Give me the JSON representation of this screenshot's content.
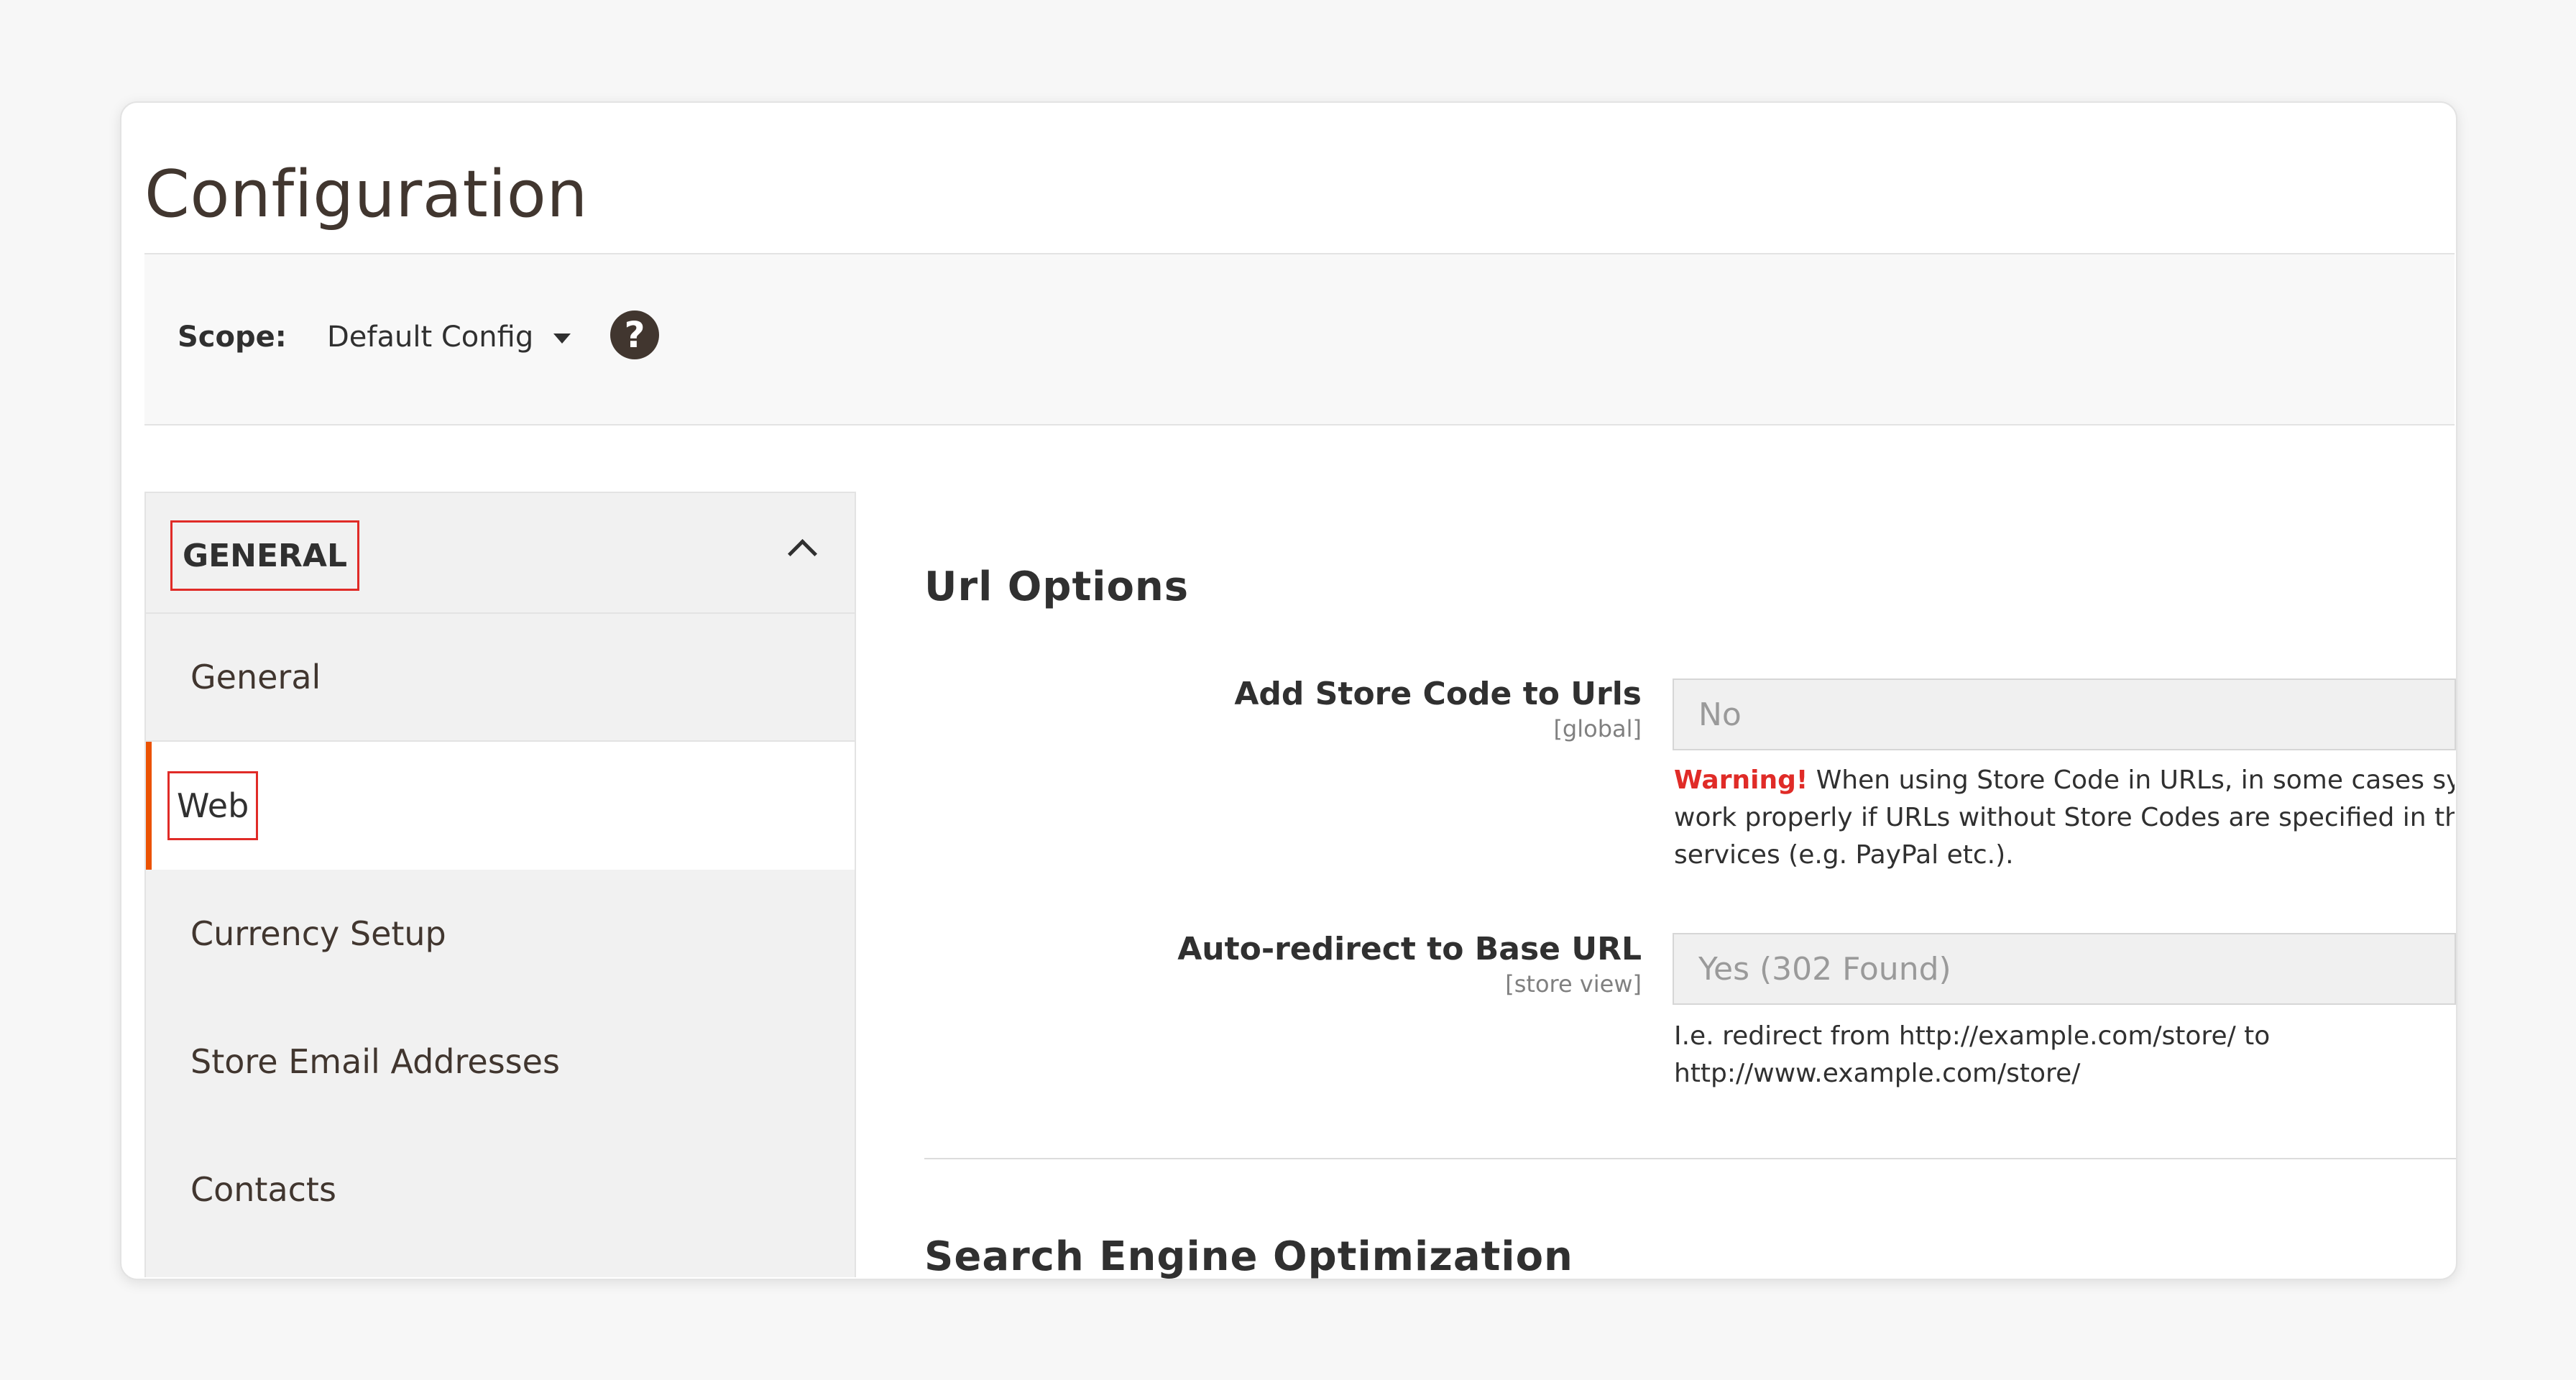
{
  "page": {
    "title": "Configuration"
  },
  "scope": {
    "label": "Scope:",
    "value": "Default Config"
  },
  "sidebar": {
    "section_title": "GENERAL",
    "items": [
      {
        "label": "General"
      },
      {
        "label": "Web"
      },
      {
        "label": "Currency Setup"
      },
      {
        "label": "Store Email Addresses"
      },
      {
        "label": "Contacts"
      }
    ],
    "active_item": "Web"
  },
  "main": {
    "url_options": {
      "title": "Url Options",
      "add_store_code": {
        "label": "Add Store Code to Urls",
        "scope": "[global]",
        "value": "No",
        "note_warning": "Warning!",
        "note_line1": " When using Store Code in URLs, in some cases syster",
        "note_line2": "work properly if URLs without Store Codes are specified in the t",
        "note_line3": "services (e.g. PayPal etc.)."
      },
      "auto_redirect": {
        "label": "Auto-redirect to Base URL",
        "scope": "[store view]",
        "value": "Yes (302 Found)",
        "note_line1": "I.e. redirect from http://example.com/store/ to",
        "note_line2": "http://www.example.com/store/"
      }
    },
    "seo": {
      "title": "Search Engine Optimization"
    }
  },
  "colors": {
    "accent": "#eb5202",
    "highlight_box": "#e02b27",
    "warning": "#e02b27"
  }
}
